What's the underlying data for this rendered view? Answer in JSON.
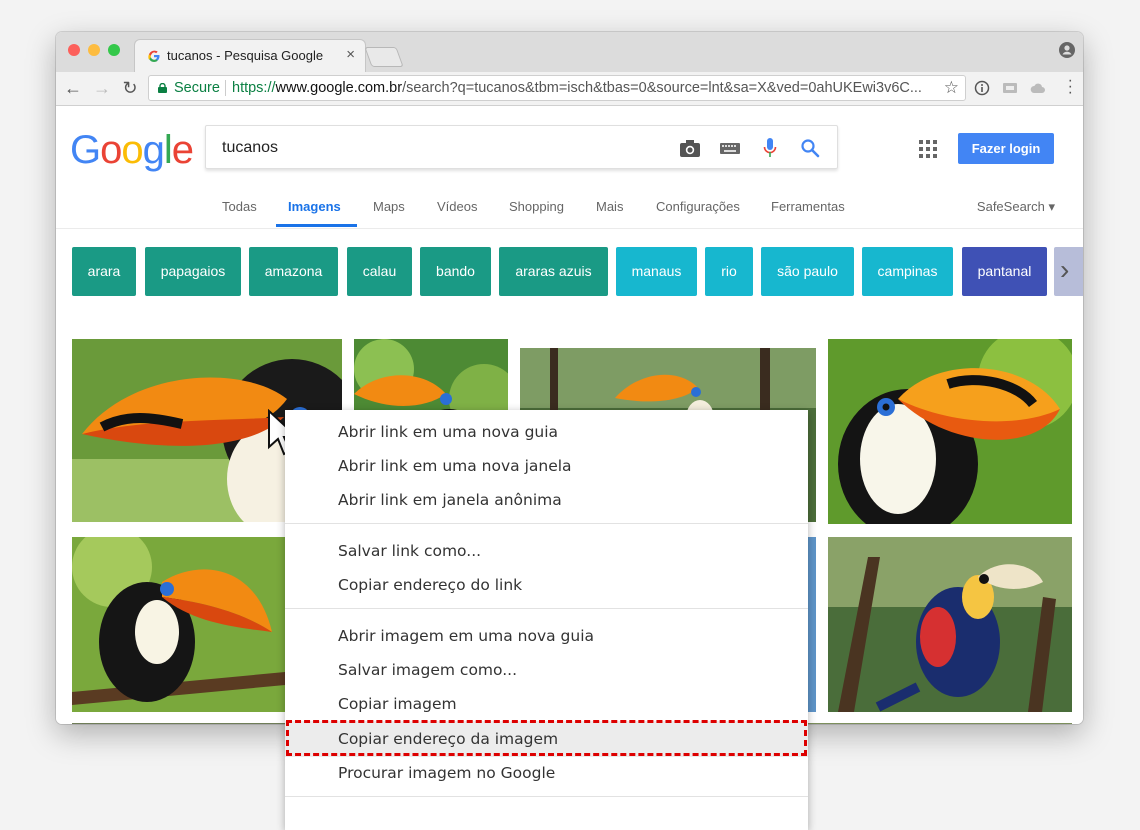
{
  "browser": {
    "tab_title": "tucanos - Pesquisa Google",
    "tab_close": "×",
    "secure_label": "Secure",
    "url_scheme": "https://",
    "url_host": "www.google.com.br",
    "url_path": "/search?q=tucanos&tbm=isch&tbas=0&source=lnt&sa=X&ved=0ahUKEwi3v6C...",
    "back_icon": "←",
    "forward_icon": "→",
    "reload_icon": "↻",
    "star_icon": "☆"
  },
  "google": {
    "logo": [
      "G",
      "o",
      "o",
      "g",
      "l",
      "e"
    ],
    "logo_colors": [
      "#4285f4",
      "#ea4335",
      "#fbbc05",
      "#4285f4",
      "#34a853",
      "#ea4335"
    ],
    "query": "tucanos",
    "login_label": "Fazer login",
    "tabs": [
      "Todas",
      "Imagens",
      "Maps",
      "Vídeos",
      "Shopping",
      "Mais",
      "Configurações",
      "Ferramentas"
    ],
    "active_tab": "Imagens",
    "safesearch": "SafeSearch ▾",
    "chips": [
      "arara",
      "papagaios",
      "amazona",
      "calau",
      "bando",
      "araras azuis",
      "manaus",
      "rio",
      "são paulo",
      "campinas",
      "pantanal"
    ],
    "chip_colors": [
      "#1a9a85",
      "#1a9a85",
      "#1a9a85",
      "#1a9a85",
      "#1a9a85",
      "#1a9a85",
      "#17b7cf",
      "#17b7cf",
      "#17b7cf",
      "#17b7cf",
      "#3f51b5"
    ],
    "chip_next_icon": "›"
  },
  "context_menu": {
    "items": [
      "Abrir link em uma nova guia",
      "Abrir link em uma nova janela",
      "Abrir link em janela anônima",
      "Salvar link como...",
      "Copiar endereço do link",
      "Abrir imagem em uma nova guia",
      "Salvar imagem como...",
      "Copiar imagem",
      "Copiar endereço da imagem",
      "Procurar imagem no Google"
    ],
    "highlighted": "Copiar endereço da imagem"
  }
}
